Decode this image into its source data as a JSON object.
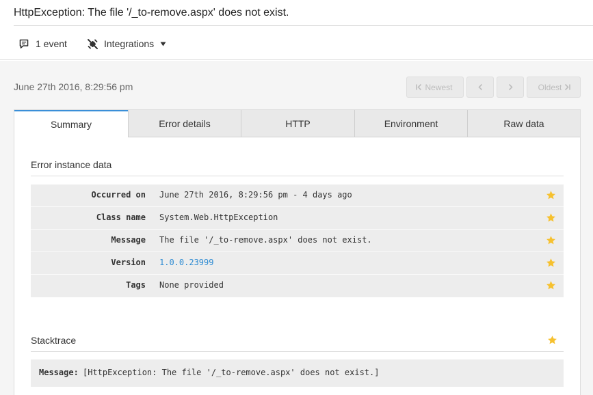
{
  "header": {
    "title": "HttpException: The file '/_to-remove.aspx' does not exist.",
    "events_label": "1 event",
    "integrations_label": "Integrations"
  },
  "occurrence": {
    "date": "June 27th 2016, 8:29:56 pm",
    "pager": {
      "newest_label": "Newest",
      "oldest_label": "Oldest"
    }
  },
  "tabs": [
    {
      "label": "Summary",
      "active": true
    },
    {
      "label": "Error details",
      "active": false
    },
    {
      "label": "HTTP",
      "active": false
    },
    {
      "label": "Environment",
      "active": false
    },
    {
      "label": "Raw data",
      "active": false
    }
  ],
  "instance": {
    "title": "Error instance data",
    "rows": [
      {
        "label": "Occurred on",
        "value": "June 27th 2016, 8:29:56 pm - 4 days ago"
      },
      {
        "label": "Class name",
        "value": "System.Web.HttpException"
      },
      {
        "label": "Message",
        "value": "The file '/_to-remove.aspx' does not exist."
      },
      {
        "label": "Version",
        "value": "1.0.0.23999"
      },
      {
        "label": "Tags",
        "value": "None provided"
      }
    ]
  },
  "stacktrace": {
    "title": "Stacktrace",
    "message_label": "Message:",
    "message_value": "[HttpException: The file '/_to-remove.aspx' does not exist.]"
  },
  "colors": {
    "accent": "#3a8fd8",
    "link": "#2b8ad2",
    "star": "#f6c12f",
    "panel_background": "#f5f5f5",
    "table_background": "#ededed"
  },
  "icons": {
    "events": "comment-icon",
    "integrations": "puzzle-icon",
    "dropdown": "caret-down-icon",
    "star": "star-icon",
    "newest": "first-page-icon",
    "previous": "chevron-left-icon",
    "next": "chevron-right-icon",
    "oldest": "last-page-icon"
  }
}
